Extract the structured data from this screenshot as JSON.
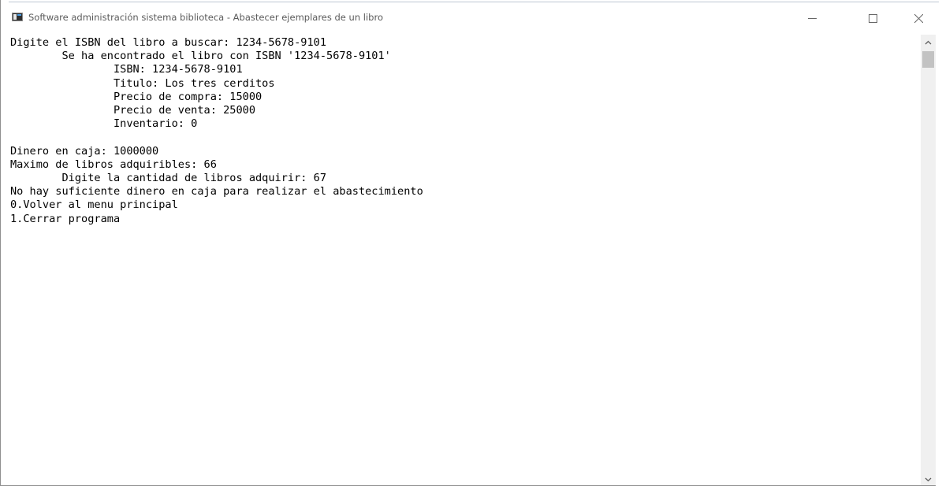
{
  "window": {
    "title": "Software administración sistema biblioteca - Abastecer ejemplares de un libro",
    "icon": "console-app-icon",
    "controls": {
      "minimize_icon": "minimize-icon",
      "maximize_icon": "maximize-icon",
      "close_icon": "close-icon"
    }
  },
  "console": {
    "lines": [
      "Digite el ISBN del libro a buscar: 1234-5678-9101",
      "        Se ha encontrado el libro con ISBN '1234-5678-9101'",
      "                ISBN: 1234-5678-9101",
      "                Titulo: Los tres cerditos",
      "                Precio de compra: 15000",
      "                Precio de venta: 25000",
      "                Inventario: 0",
      "",
      "Dinero en caja: 1000000",
      "Maximo de libros adquiribles: 66",
      "        Digite la cantidad de libros adquirir: 67",
      "No hay suficiente dinero en caja para realizar el abastecimiento",
      "0.Volver al menu principal",
      "1.Cerrar programa"
    ]
  },
  "scrollbar": {
    "up_icon": "scroll-up-arrow-icon",
    "down_icon": "scroll-down-arrow-icon",
    "thumb_color": "#c2c2c2",
    "track_color": "#f0f0f0"
  },
  "colors": {
    "text": "#000000",
    "background": "#ffffff",
    "title_text": "#5b5b5b"
  }
}
